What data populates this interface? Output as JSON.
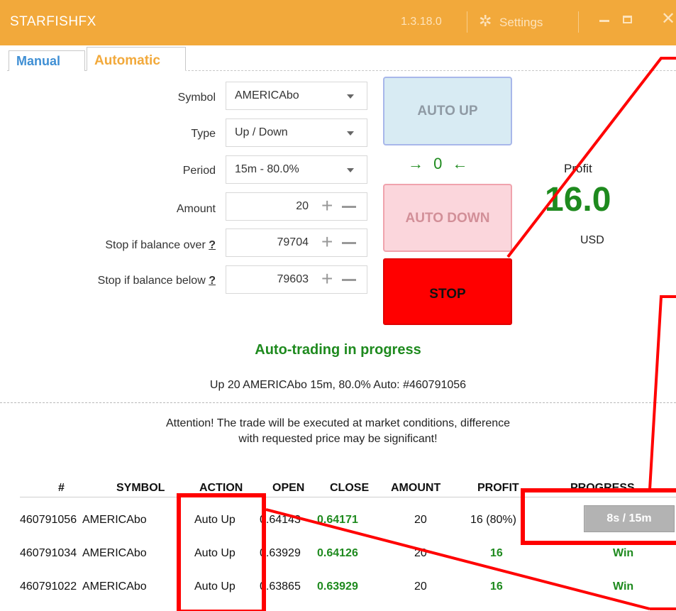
{
  "window": {
    "title": "STARFISHFX",
    "version": "1.3.18.0",
    "settings_label": "Settings"
  },
  "tabs": [
    {
      "label": "Manual"
    },
    {
      "label": "Automatic"
    }
  ],
  "form": {
    "symbol": {
      "label": "Symbol",
      "value": "AMERICAbo"
    },
    "type": {
      "label": "Type",
      "value": "Up / Down"
    },
    "period": {
      "label": "Period",
      "value": "15m - 80.0%"
    },
    "amount": {
      "label": "Amount",
      "value": "20"
    },
    "stop_over": {
      "label": "Stop if balance over",
      "help": "?",
      "value": "79704"
    },
    "stop_below": {
      "label": "Stop if balance below",
      "help": "?",
      "value": "79603"
    }
  },
  "buttons": {
    "auto_up": "AUTO UP",
    "auto_down": "AUTO DOWN",
    "stop": "STOP"
  },
  "counter": {
    "left_arrow": "→",
    "value": "0",
    "right_arrow": "←"
  },
  "profit": {
    "label": "Profit",
    "value": "16.0",
    "currency": "USD"
  },
  "status": {
    "headline": "Auto-trading in progress",
    "detail": "Up 20 AMERICAbo 15m, 80.0% Auto: #460791056"
  },
  "attention": {
    "line1": "Attention! The trade will be executed at market conditions, difference",
    "line2": "with requested price may be significant!"
  },
  "table": {
    "headers": [
      "#",
      "SYMBOL",
      "ACTION",
      "OPEN",
      "CLOSE",
      "AMOUNT",
      "PROFIT",
      "PROGRESS"
    ],
    "rows": [
      {
        "id": "460791056",
        "symbol": "AMERICAbo",
        "action": "Auto Up",
        "open": "0.64143",
        "close": "0.64171",
        "amount": "20",
        "profit": "16 (80%)",
        "progress": "8s / 15m",
        "progress_fraction": 0.01
      },
      {
        "id": "460791034",
        "symbol": "AMERICAbo",
        "action": "Auto Up",
        "open": "0.63929",
        "close": "0.64126",
        "amount": "20",
        "profit": "16",
        "progress": "Win"
      },
      {
        "id": "460791022",
        "symbol": "AMERICAbo",
        "action": "Auto Up",
        "open": "0.63865",
        "close": "0.63929",
        "amount": "20",
        "profit": "16",
        "progress": "Win"
      }
    ]
  },
  "colors": {
    "titlebar": "#f2a93b",
    "green": "#1e8a1e",
    "stop": "#ff0000",
    "annotation": "#ff0000"
  }
}
